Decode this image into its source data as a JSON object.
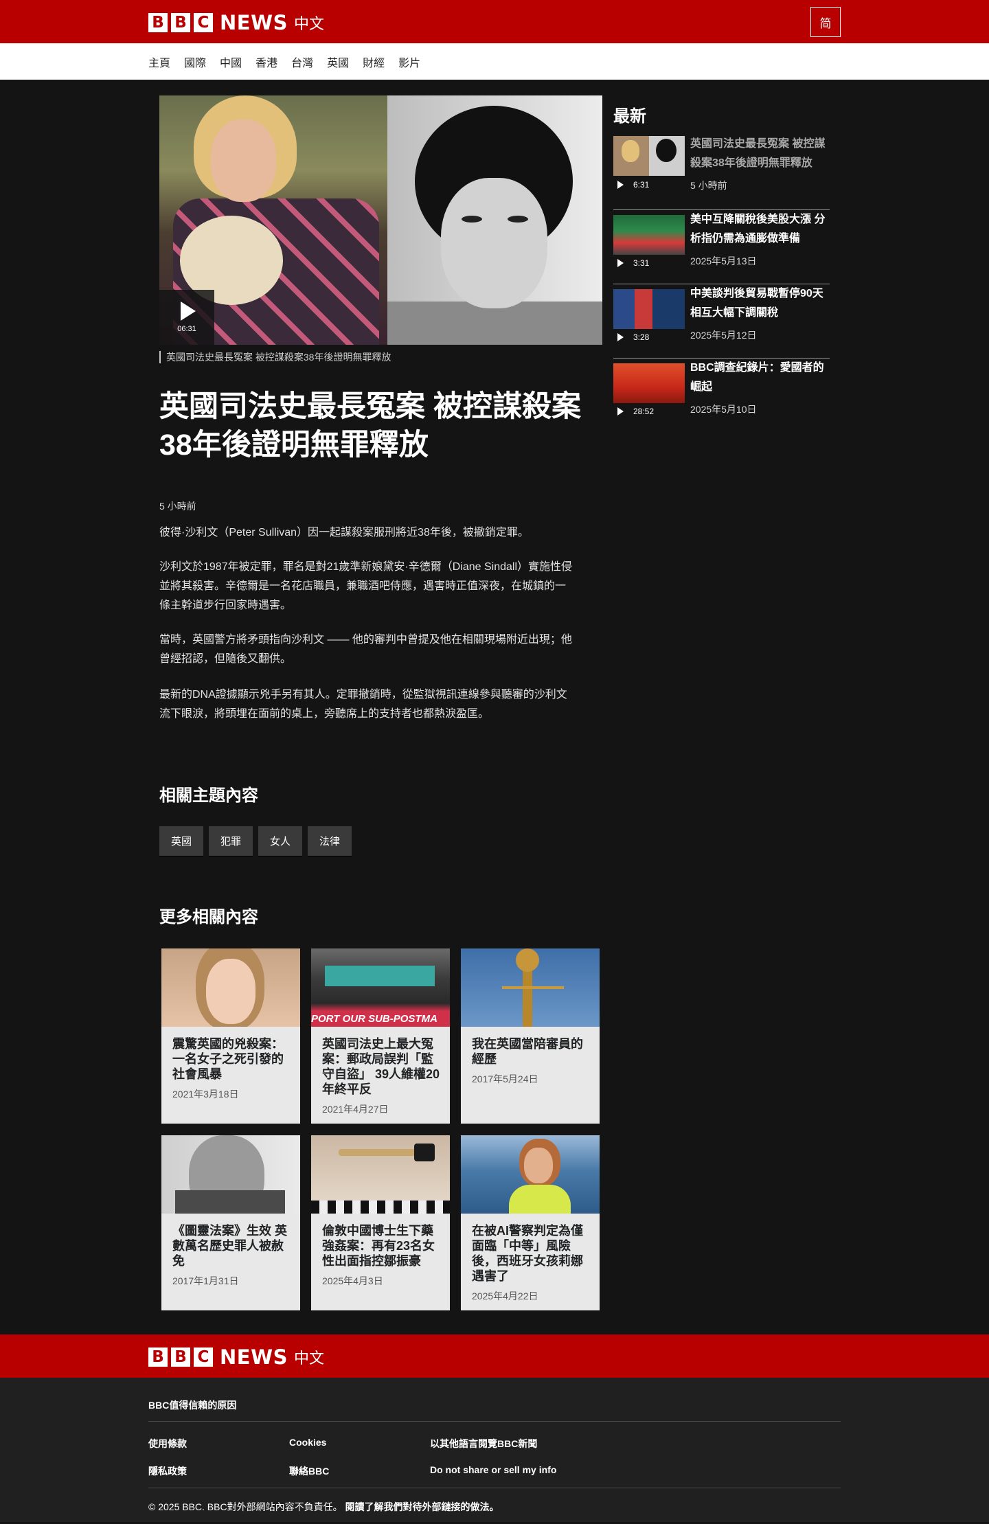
{
  "header": {
    "brand_b1": "B",
    "brand_b2": "B",
    "brand_c": "C",
    "brand_news": "NEWS",
    "brand_lang": "中文",
    "lang_toggle": "简"
  },
  "nav": {
    "items": [
      "主頁",
      "國際",
      "中國",
      "香港",
      "台灣",
      "英國",
      "財經",
      "影片"
    ]
  },
  "hero": {
    "duration": "06:31",
    "caption": "英國司法史最長冤案 被控謀殺案38年後證明無罪釋放",
    "headline": "英國司法史最長冤案 被控謀殺案38年後證明無罪釋放",
    "timestamp": "5 小時前"
  },
  "article": {
    "paragraphs": [
      "彼得·沙利文（Peter Sullivan）因一起謀殺案服刑將近38年後，被撤銷定罪。",
      "沙利文於1987年被定罪，罪名是對21歲準新娘黛安·辛德爾（Diane Sindall）實施性侵並將其殺害。辛德爾是一名花店職員，兼職酒吧侍應，遇害時正值深夜，在城鎮的一條主幹道步行回家時遇害。",
      "當時，英國警方將矛頭指向沙利文 —— 他的審判中曾提及他在相關現場附近出現；他曾經招認，但隨後又翻供。",
      "最新的DNA證據顯示兇手另有其人。定罪撤銷時，從監獄視訊連線參與聽審的沙利文流下眼淚，將頭埋在面前的桌上，旁聽席上的支持者也都熱淚盈匡。"
    ]
  },
  "related_topics": {
    "title": "相關主題內容",
    "tags": [
      "英國",
      "犯罪",
      "女人",
      "法律"
    ]
  },
  "more_related": {
    "title": "更多相關內容",
    "cards": [
      {
        "title": "震驚英國的兇殺案：一名女子之死引發的社會風暴",
        "date": "2021年3月18日"
      },
      {
        "title": "英國司法史上最大冤案：郵政局誤判「監守自盜」 39人維權20年終平反",
        "date": "2021年4月27日"
      },
      {
        "title": "我在英國當陪審員的經歷",
        "date": "2017年5月24日"
      },
      {
        "title": "《圖靈法案》生效 英數萬名歷史罪人被赦免",
        "date": "2017年1月31日"
      },
      {
        "title": "倫敦中國博士生下藥強姦案：再有23名女性出面指控鄒振豪",
        "date": "2025年4月3日"
      },
      {
        "title": "在被AI警察判定為僅面臨「中等」風險後，西班牙女孩莉娜遇害了",
        "date": "2025年4月22日"
      }
    ],
    "banner_text": "PORT OUR SUB-POSTMA"
  },
  "sidebar": {
    "title": "最新",
    "items": [
      {
        "duration": "6:31",
        "title": "英國司法史最長冤案 被控謀殺案38年後證明無罪釋放",
        "date": "5 小時前"
      },
      {
        "duration": "3:31",
        "title": "美中互降關稅後美股大漲 分析指仍需為通膨做準備",
        "date": "2025年5月13日"
      },
      {
        "duration": "3:28",
        "title": "中美談判後貿易戰暫停90天 相互大幅下調關稅",
        "date": "2025年5月12日"
      },
      {
        "duration": "28:52",
        "title": "BBC調查紀錄片：愛國者的崛起",
        "date": "2025年5月10日"
      }
    ]
  },
  "footer": {
    "trust": "BBC值得信賴的原因",
    "links": [
      "使用條款",
      "Cookies",
      "以其他語言閱覽BBC新聞",
      "隱私政策",
      "聯絡BBC",
      "Do not share or sell my info"
    ],
    "copyright": "© 2025 BBC. BBC對外部網站內容不負責任。",
    "copyright_link": "閱讀了解我們對待外部鏈接的做法。"
  },
  "colors": {
    "brand_red": "#b80000",
    "page_bg": "#141414",
    "card_bg": "#e8e8e8",
    "footer_bg": "#202020"
  },
  "icons": [
    "play-icon",
    "bbc-logo"
  ]
}
